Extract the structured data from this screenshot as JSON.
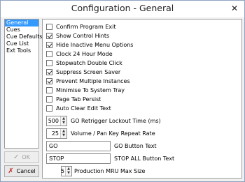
{
  "window": {
    "title": "Configuration - General",
    "close_glyph": "✕"
  },
  "sidebar": {
    "items": [
      {
        "label": "General",
        "selected": true
      },
      {
        "label": "Cues",
        "selected": false
      },
      {
        "label": "Cue Defaults",
        "selected": false
      },
      {
        "label": "Cue List",
        "selected": false
      },
      {
        "label": "Ext Tools",
        "selected": false
      }
    ]
  },
  "options": [
    {
      "label": "Confirm Program Exit",
      "checked": false
    },
    {
      "label": "Show Control Hints",
      "checked": true
    },
    {
      "label": "Hide Inactive Menu Options",
      "checked": true
    },
    {
      "label": "Clock 24 Hour Mode",
      "checked": false
    },
    {
      "label": "Stopwatch Double Click",
      "checked": false
    },
    {
      "label": "Suppress Screen Saver",
      "checked": true
    },
    {
      "label": "Prevent Multiple Instances",
      "checked": true
    },
    {
      "label": "Minimise To System Tray",
      "checked": false
    },
    {
      "label": "Page Tab Persist",
      "checked": false
    },
    {
      "label": "Auto Clear Edit Text",
      "checked": false
    }
  ],
  "fields": {
    "go_retrigger": {
      "value": "500",
      "label": "GO Retrigger Lockout Time (ms)"
    },
    "volume_pan": {
      "value": "25",
      "label": "Volume / Pan Key Repeat Rate"
    },
    "go_button": {
      "value": "GO",
      "label": "GO Button Text"
    },
    "stop_all": {
      "value": "STOP",
      "label": "STOP ALL Button Text"
    },
    "mru": {
      "value": "5",
      "label": "Production MRU Max Size"
    }
  },
  "buttons": {
    "ok": {
      "label": "OK",
      "icon": "check-icon",
      "glyph": "✓"
    },
    "cancel": {
      "label": "Cancel",
      "icon": "x-icon",
      "glyph": "✗"
    }
  }
}
